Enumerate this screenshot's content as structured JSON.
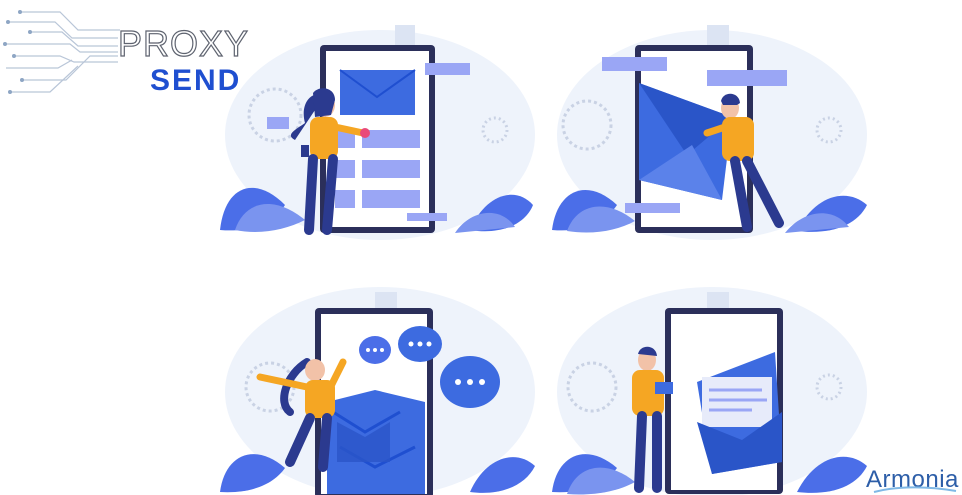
{
  "logo": {
    "word_top": "PROXY",
    "word_bottom": "SEND"
  },
  "watermark": {
    "text": "Armonia"
  },
  "colors": {
    "brand_blue": "#1f4fd0",
    "envelope_blue": "#3d6be0",
    "panel_lavender": "#9aa6f5",
    "shirt_orange": "#f5a623",
    "phone_frame": "#2b2f5a",
    "leaf_blue": "#4b6ee8"
  }
}
